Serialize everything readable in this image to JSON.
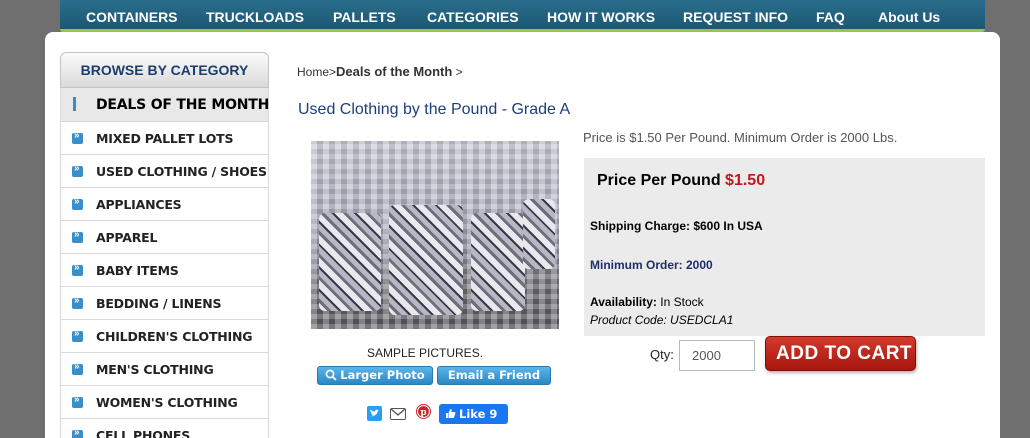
{
  "nav": [
    "CONTAINERS",
    "TRUCKLOADS",
    "PALLETS",
    "CATEGORIES",
    "HOW IT WORKS",
    "REQUEST INFO",
    "FAQ",
    "About Us"
  ],
  "sidebar": {
    "header": "BROWSE BY CATEGORY",
    "items": [
      {
        "label": "DEALS OF THE MONTH"
      },
      {
        "label": "MIXED PALLET LOTS"
      },
      {
        "label": "USED CLOTHING / SHOES"
      },
      {
        "label": "APPLIANCES"
      },
      {
        "label": "APPAREL"
      },
      {
        "label": "BABY ITEMS"
      },
      {
        "label": "BEDDING / LINENS"
      },
      {
        "label": "CHILDREN'S CLOTHING"
      },
      {
        "label": "MEN'S CLOTHING"
      },
      {
        "label": "WOMEN'S CLOTHING"
      },
      {
        "label": "CELL PHONES"
      }
    ]
  },
  "breadcrumb": {
    "home": "Home",
    "sep": ">",
    "current": "Deals of the Month"
  },
  "product": {
    "title": "Used Clothing by the Pound - Grade A",
    "sample_label": "SAMPLE PICTURES.",
    "larger_photo": "Larger Photo",
    "email_friend": "Email a Friend",
    "like_label": "Like 9",
    "price_note": "Price is $1.50 Per Pound. Minimum Order is 2000 Lbs.",
    "ppp_label": "Price Per Pound",
    "ppp_value": "$1.50",
    "shipping": "Shipping Charge: $600 In USA",
    "min_order": "Minimum Order: 2000",
    "availability_label": "Availability:",
    "availability_value": "In Stock",
    "product_code": "Product Code: USEDCLA1",
    "qty_label": "Qty:",
    "qty_value": "2000",
    "cart_label": "ADD TO CART"
  },
  "colors": {
    "nav_bg": "#1b5873",
    "accent_red": "#c8141c",
    "title_blue": "#1c3f7c"
  }
}
